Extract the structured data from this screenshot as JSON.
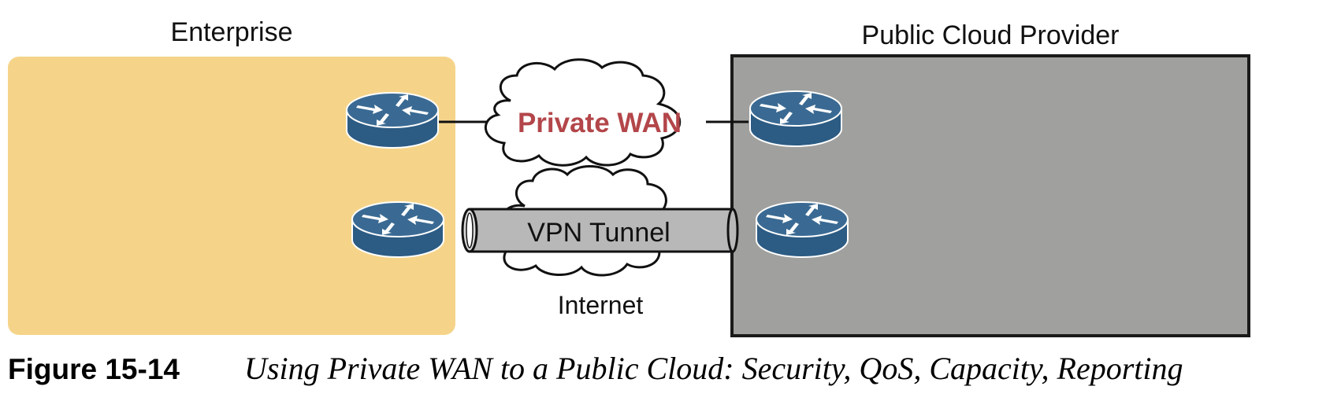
{
  "regions": {
    "enterprise_label": "Enterprise",
    "cloud_label": "Public Cloud Provider"
  },
  "clouds": {
    "private_wan_label": "Private WAN",
    "internet_label": "Internet"
  },
  "tunnel": {
    "label": "VPN Tunnel"
  },
  "caption": {
    "number": "Figure 15-14",
    "title": "Using Private WAN to a Public Cloud: Security, QoS, Capacity, Reporting"
  },
  "icons": {
    "router": "router-icon",
    "cloud": "cloud-icon",
    "tunnel": "vpn-tunnel-icon"
  },
  "colors": {
    "enterprise_fill": "#f5d48a",
    "cloud_provider_fill": "#a0a09e",
    "router_fill": "#2f5f86",
    "private_wan_text": "#b3464a",
    "tunnel_fill": "#b8b8b8"
  }
}
